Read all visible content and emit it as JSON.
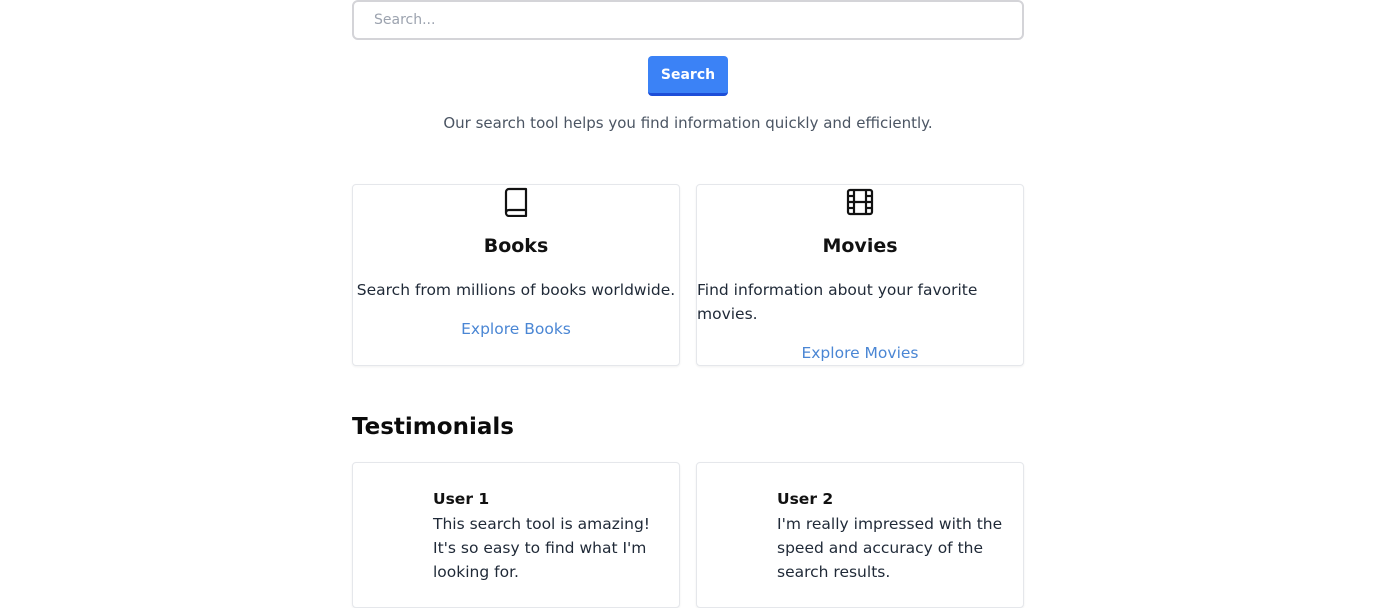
{
  "search": {
    "placeholder": "Search...",
    "value": "",
    "button_label": "Search"
  },
  "tagline": "Our search tool helps you find information quickly and efficiently.",
  "categories": [
    {
      "icon": "book-icon",
      "title": "Books",
      "description": "Search from millions of books worldwide.",
      "link": "Explore Books"
    },
    {
      "icon": "film-icon",
      "title": "Movies",
      "description": "Find information about your favorite movies.",
      "link": "Explore Movies"
    }
  ],
  "testimonials": {
    "title": "Testimonials",
    "items": [
      {
        "name": "User 1",
        "quote": "This search tool is amazing! It's so easy to find what I'm looking for."
      },
      {
        "name": "User 2",
        "quote": "I'm really impressed with the speed and accuracy of the search results."
      }
    ]
  },
  "colors": {
    "accent": "#3b82f6",
    "link": "#4a86d4",
    "muted_text": "#4b5563"
  }
}
